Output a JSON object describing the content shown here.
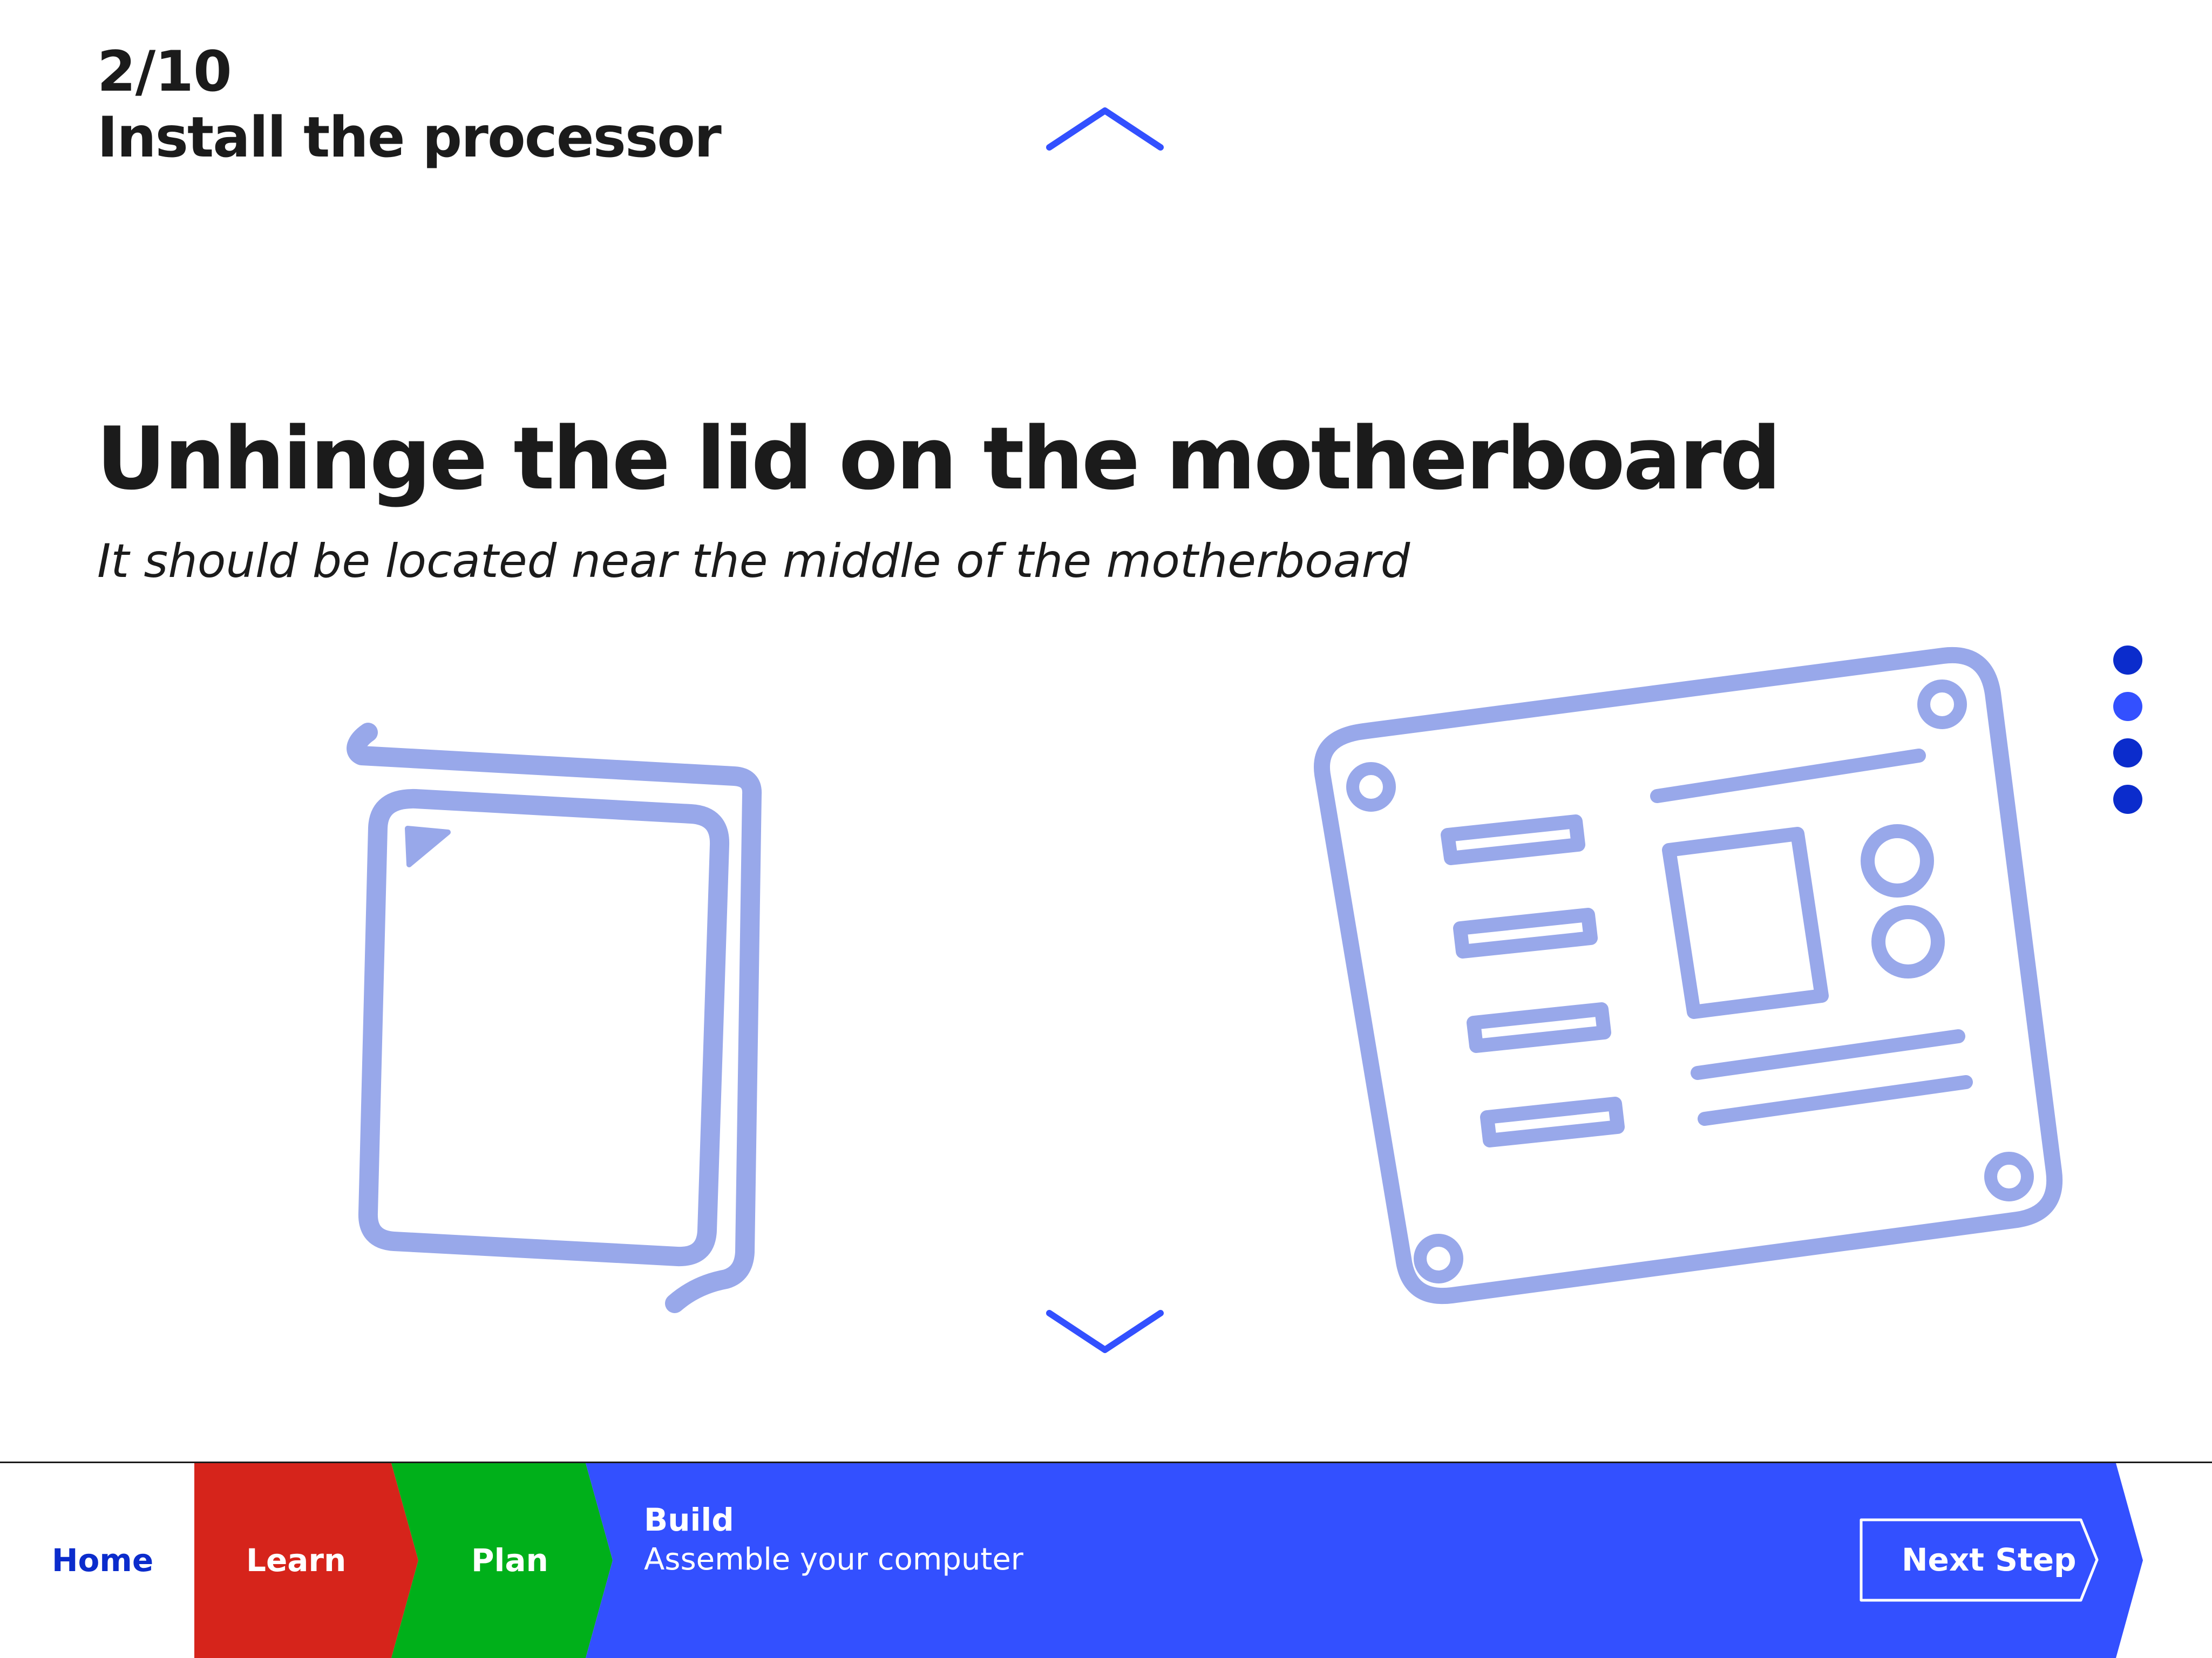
{
  "header": {
    "step_count": "2/10",
    "step_title": "Install the processor"
  },
  "instruction": {
    "title": "Unhinge the lid on the motherboard",
    "subtitle": "It should be located near the middle of the motherboard"
  },
  "icons": {
    "up": "chevron-up-icon",
    "down": "chevron-down-icon",
    "cpu": "cpu-chip-icon",
    "motherboard": "motherboard-icon"
  },
  "pager": {
    "count": 4,
    "colors": [
      "#0b2ccc",
      "#3350ff",
      "#0b2ccc",
      "#0b2ccc"
    ]
  },
  "nav": {
    "home": "Home",
    "learn": "Learn",
    "plan": "Plan",
    "build_title": "Build",
    "build_subtitle": "Assemble your computer",
    "next_step": "Next Step"
  },
  "colors": {
    "accent": "#3350ff",
    "illustration": "#98a8ea",
    "learn": "#d6241b",
    "plan": "#00b01a",
    "build": "#3350ff",
    "home_text": "#0b2ccc",
    "text": "#1b1b1b"
  }
}
